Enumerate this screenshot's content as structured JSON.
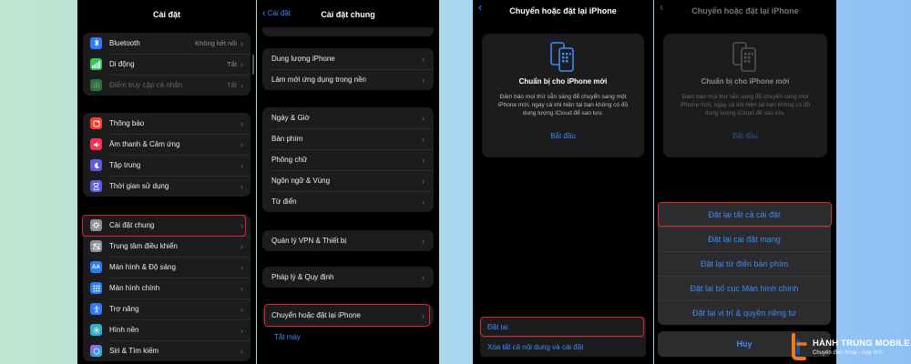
{
  "screen1": {
    "title": "Cài đặt",
    "group1": [
      {
        "label": "Bluetooth",
        "value": "Không kết nối",
        "icon": "bluetooth-icon",
        "color": "#2f7cf6"
      },
      {
        "label": "Di động",
        "value": "Tắt",
        "icon": "cellular-icon",
        "color": "#34c759"
      },
      {
        "label": "Điểm truy cập cá nhân",
        "value": "Tắt",
        "icon": "hotspot-icon",
        "color": "#34c759",
        "dim": true
      }
    ],
    "group2": [
      {
        "label": "Thông báo",
        "icon": "notifications-icon",
        "color": "#ff3b30"
      },
      {
        "label": "Âm thanh & Cảm ứng",
        "icon": "sound-icon",
        "color": "#ff2d55"
      },
      {
        "label": "Tập trung",
        "icon": "focus-moon-icon",
        "color": "#5e5ce6"
      },
      {
        "label": "Thời gian sử dụng",
        "icon": "screen-time-icon",
        "color": "#5e5ce6"
      }
    ],
    "group3": [
      {
        "label": "Cài đặt chung",
        "icon": "gear-icon",
        "color": "#8e8e93"
      },
      {
        "label": "Trung tâm điều khiển",
        "icon": "control-center-icon",
        "color": "#8e8e93"
      },
      {
        "label": "Màn hình & Độ sáng",
        "icon": "display-brightness-icon",
        "color": "#2f7cf6"
      },
      {
        "label": "Màn hình chính",
        "icon": "home-screen-icon",
        "color": "#2f7cf6"
      },
      {
        "label": "Trợ năng",
        "icon": "accessibility-icon",
        "color": "#2f7cf6"
      },
      {
        "label": "Hình nền",
        "icon": "wallpaper-icon",
        "color": "#30b0c7"
      },
      {
        "label": "Siri & Tìm kiếm",
        "icon": "siri-icon",
        "color": "#333333"
      }
    ]
  },
  "screen2": {
    "back": "Cài đặt",
    "title": "Cài đặt chung",
    "group1": [
      "Dung lượng iPhone",
      "Làm mới ứng dụng trong nền"
    ],
    "group2": [
      "Ngày & Giờ",
      "Bàn phím",
      "Phông chữ",
      "Ngôn ngữ & Vùng",
      "Từ điển"
    ],
    "group3": [
      "Quản lý VPN & Thiết bị"
    ],
    "group4": [
      "Pháp lý & Quy định"
    ],
    "group5": [
      "Chuyển hoặc đặt lại iPhone"
    ],
    "shutdown": "Tắt máy"
  },
  "screen3": {
    "title": "Chuyển hoặc đặt lại iPhone",
    "card_title": "Chuẩn bị cho iPhone mới",
    "card_desc": "Đảm bảo mọi thứ sẵn sàng để chuyển sang một iPhone mới, ngay cả khi hiện tại bạn không có đủ dung lượng iCloud để sao lưu.",
    "card_link": "Bắt đầu",
    "reset": "Đặt lại",
    "erase": "Xóa tất cả nội dung và cài đặt"
  },
  "screen4": {
    "title": "Chuyển hoặc đặt lại iPhone",
    "card_title": "Chuẩn bị cho iPhone mới",
    "card_desc": "Đảm bảo mọi thứ sẵn sàng để chuyển sang một iPhone mới, ngay cả khi hiện tại bạn không có đủ dung lượng iCloud để sao lưu.",
    "card_link": "Bắt đầu",
    "options": [
      "Đặt lại tất cả cài đặt",
      "Đặt lại cài đặt mạng",
      "Đặt lại từ điển bàn phím",
      "Đặt lại bố cục Màn hình chính",
      "Đặt lại vị trí & quyền riêng tư"
    ],
    "cancel": "Hủy"
  },
  "watermark": {
    "brand": "HÀNH TRUNG MOBILE",
    "slogan": "Chuyên điện thoại - máy tính"
  }
}
